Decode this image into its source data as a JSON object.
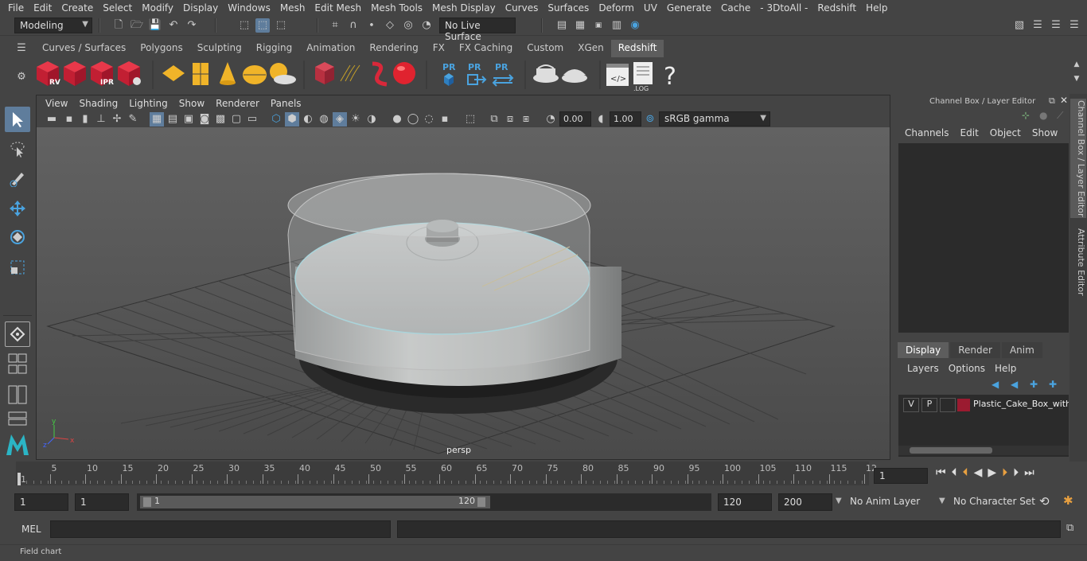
{
  "menubar": {
    "items": [
      "File",
      "Edit",
      "Create",
      "Select",
      "Modify",
      "Display",
      "Windows",
      "Mesh",
      "Edit Mesh",
      "Mesh Tools",
      "Mesh Display",
      "Curves",
      "Surfaces",
      "Deform",
      "UV",
      "Generate",
      "Cache",
      "- 3DtoAll -",
      "Redshift",
      "Help"
    ]
  },
  "statusline": {
    "mode": "Modeling",
    "live_surface": "No Live Surface"
  },
  "shelf": {
    "tabs": [
      "Curves / Surfaces",
      "Polygons",
      "Sculpting",
      "Rigging",
      "Animation",
      "Rendering",
      "FX",
      "FX Caching",
      "Custom",
      "XGen",
      "Redshift"
    ],
    "active_tab": "Redshift",
    "icon_labels": {
      "rv": "RV",
      "ipr": "IPR",
      "pr": "PR",
      "log": ".LOG",
      "help": "?"
    }
  },
  "viewport": {
    "menu": [
      "View",
      "Shading",
      "Lighting",
      "Show",
      "Renderer",
      "Panels"
    ],
    "exposure": "0.00",
    "gamma": "1.00",
    "color_space": "sRGB gamma",
    "camera_label": "persp",
    "axis": {
      "x": "x",
      "y": "y",
      "z": "z"
    }
  },
  "channel_box": {
    "title": "Channel Box / Layer Editor",
    "menu": [
      "Channels",
      "Edit",
      "Object",
      "Show"
    ]
  },
  "layer_editor": {
    "tabs": [
      "Display",
      "Render",
      "Anim"
    ],
    "active_tab": "Display",
    "menu": [
      "Layers",
      "Options",
      "Help"
    ],
    "layers": [
      {
        "v": "V",
        "p": "P",
        "color": "#9b1b30",
        "name": "Plastic_Cake_Box_with"
      }
    ]
  },
  "side_tabs": [
    "Channel Box / Layer Editor",
    "Attribute Editor"
  ],
  "timeline": {
    "ticks": [
      "1",
      "5",
      "10",
      "15",
      "20",
      "25",
      "30",
      "35",
      "40",
      "45",
      "50",
      "55",
      "60",
      "65",
      "70",
      "75",
      "80",
      "85",
      "90",
      "95",
      "100",
      "105",
      "110",
      "115",
      "12"
    ],
    "current_frame": "1"
  },
  "range": {
    "start": "1",
    "playback_start": "1",
    "slider_start": "1",
    "slider_end": "120",
    "playback_end": "120",
    "end": "200",
    "anim_layer": "No Anim Layer",
    "character_set": "No Character Set"
  },
  "command": {
    "label": "MEL"
  },
  "helpline": {
    "text": "Field chart"
  }
}
